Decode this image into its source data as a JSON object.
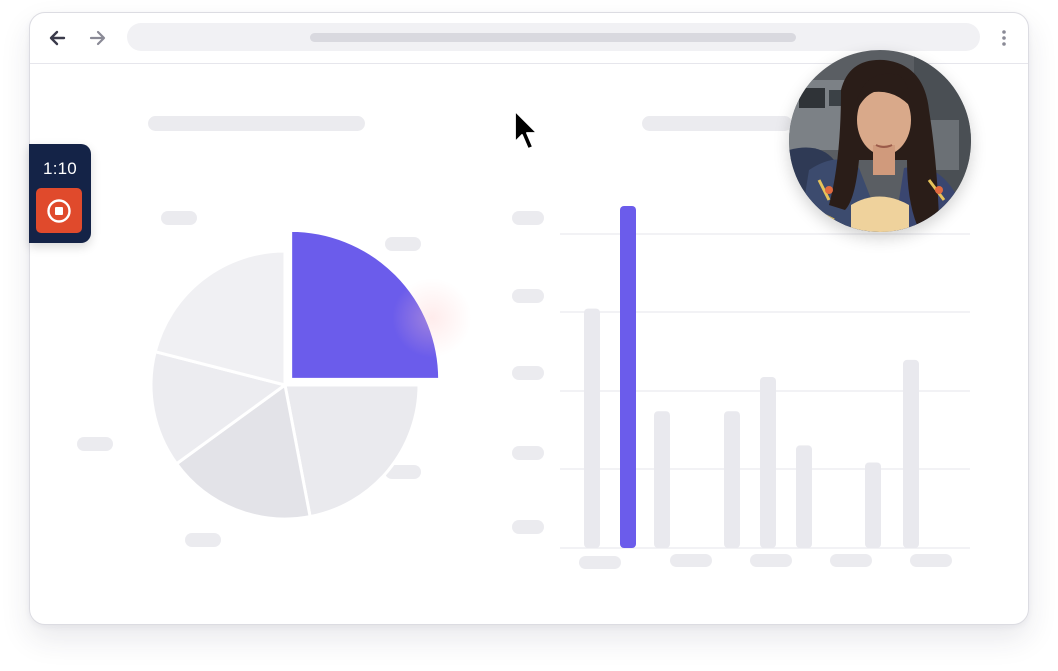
{
  "recorder": {
    "timer": "1:10",
    "stop_icon": "stop-record-icon",
    "accent": "#e04a2c",
    "panel_color": "#142347"
  },
  "browser": {
    "back_icon": "arrow-left-icon",
    "forward_icon": "arrow-right-icon",
    "menu_icon": "vertical-dots-icon"
  },
  "charts": {
    "accent_color": "#6b5ceb",
    "muted_color": "#e9e9ee"
  },
  "chart_data": [
    {
      "type": "pie",
      "values": [
        25,
        22,
        18,
        14,
        21
      ],
      "highlighted_index": 0
    },
    {
      "type": "bar",
      "values": [
        70,
        100,
        40,
        40,
        50,
        30,
        25,
        55
      ],
      "highlighted_index": 1,
      "grid": true
    }
  ]
}
